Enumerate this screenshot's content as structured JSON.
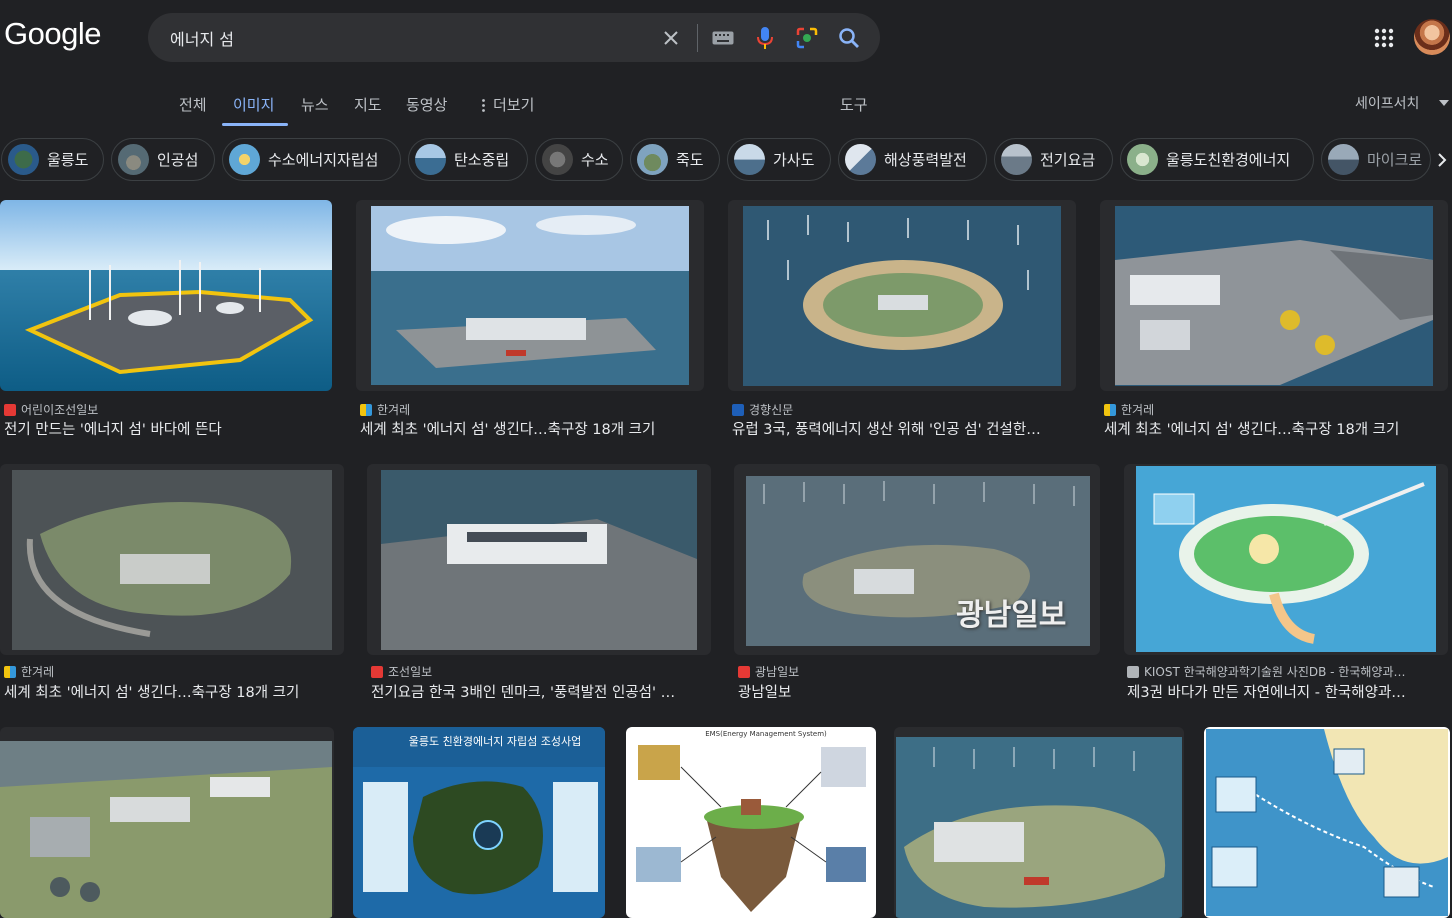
{
  "header": {
    "logo": "Google",
    "search_query": "에너지 섬"
  },
  "tabs": {
    "all": "전체",
    "images": "이미지",
    "news": "뉴스",
    "maps": "지도",
    "videos": "동영상",
    "more": "더보기",
    "tools": "도구",
    "safesearch": "세이프서치"
  },
  "chips": [
    "울릉도",
    "인공섬",
    "수소에너지자립섬",
    "탄소중립",
    "수소",
    "죽도",
    "가사도",
    "해상풍력발전",
    "전기요금",
    "울릉도친환경에너지",
    "마이크로"
  ],
  "results": [
    {
      "source": "어린이조선일보",
      "title": "전기 만드는 '에너지 섬' 바다에 뜬다"
    },
    {
      "source": "한겨레",
      "title": "세계 최초 '에너지 섬' 생긴다…축구장 18개 크기"
    },
    {
      "source": "경향신문",
      "title": "유럽 3국, 풍력에너지 생산 위해 '인공 섬' 건설한…"
    },
    {
      "source": "한겨레",
      "title": "세계 최초 '에너지 섬' 생긴다…축구장 18개 크기"
    },
    {
      "source": "한겨레",
      "title": "세계 최초 '에너지 섬' 생긴다…축구장 18개 크기"
    },
    {
      "source": "조선일보",
      "title": "전기요금 한국 3배인 덴마크, '풍력발전 인공섬' …"
    },
    {
      "source": "광남일보",
      "title": "광남일보",
      "overlay": "광남일보"
    },
    {
      "source": "KIOST 한국해양과학기술원 사진DB - 한국해양과…",
      "title": "제3권 바다가 만든 자연에너지 - 한국해양과…"
    }
  ],
  "row3_labels": {
    "ulleung_title": "울릉도 친환경에너지 자립섬 조성사업",
    "ems_title": "EMS(Energy Management System)"
  },
  "colors": {
    "background": "#202124",
    "accent": "#8ab4f8",
    "search_box": "#303134"
  }
}
